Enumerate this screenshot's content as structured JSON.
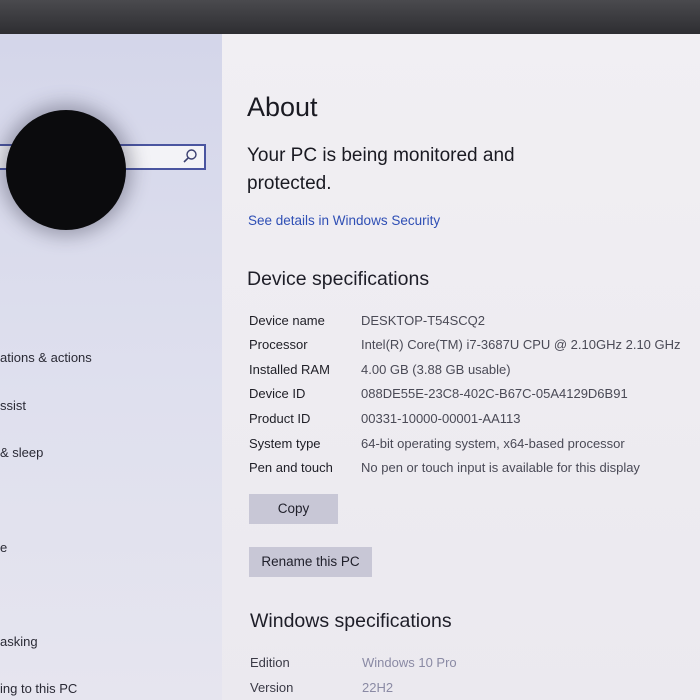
{
  "sidebar": {
    "search_placeholder": "",
    "items": [
      {
        "label": "ations & actions"
      },
      {
        "label": "ssist"
      },
      {
        "label": "& sleep"
      },
      {
        "label": "e"
      },
      {
        "label": "asking"
      },
      {
        "label": "ing to this PC"
      }
    ]
  },
  "main": {
    "title": "About",
    "monitor_heading": "Your PC is being monitored and protected.",
    "security_link": "See details in Windows Security",
    "device_specs": {
      "heading": "Device specifications",
      "rows": [
        {
          "label": "Device name",
          "value": "DESKTOP-T54SCQ2"
        },
        {
          "label": "Processor",
          "value": "Intel(R) Core(TM) i7-3687U CPU @ 2.10GHz   2.10 GHz"
        },
        {
          "label": "Installed RAM",
          "value": "4.00 GB (3.88 GB usable)"
        },
        {
          "label": "Device ID",
          "value": "088DE55E-23C8-402C-B67C-05A4129D6B91"
        },
        {
          "label": "Product ID",
          "value": "00331-10000-00001-AA113"
        },
        {
          "label": "System type",
          "value": "64-bit operating system, x64-based processor"
        },
        {
          "label": "Pen and touch",
          "value": "No pen or touch input is available for this display"
        }
      ],
      "copy_label": "Copy",
      "rename_label": "Rename this PC"
    },
    "windows_specs": {
      "heading": "Windows specifications",
      "rows": [
        {
          "label": "Edition",
          "value": "Windows 10 Pro"
        },
        {
          "label": "Version",
          "value": "22H2"
        }
      ]
    }
  },
  "colors": {
    "accent_link": "#2f4fb5",
    "button_bg": "#c8c7d6",
    "search_border": "#4a55a0"
  },
  "icons": [
    "search-icon"
  ]
}
